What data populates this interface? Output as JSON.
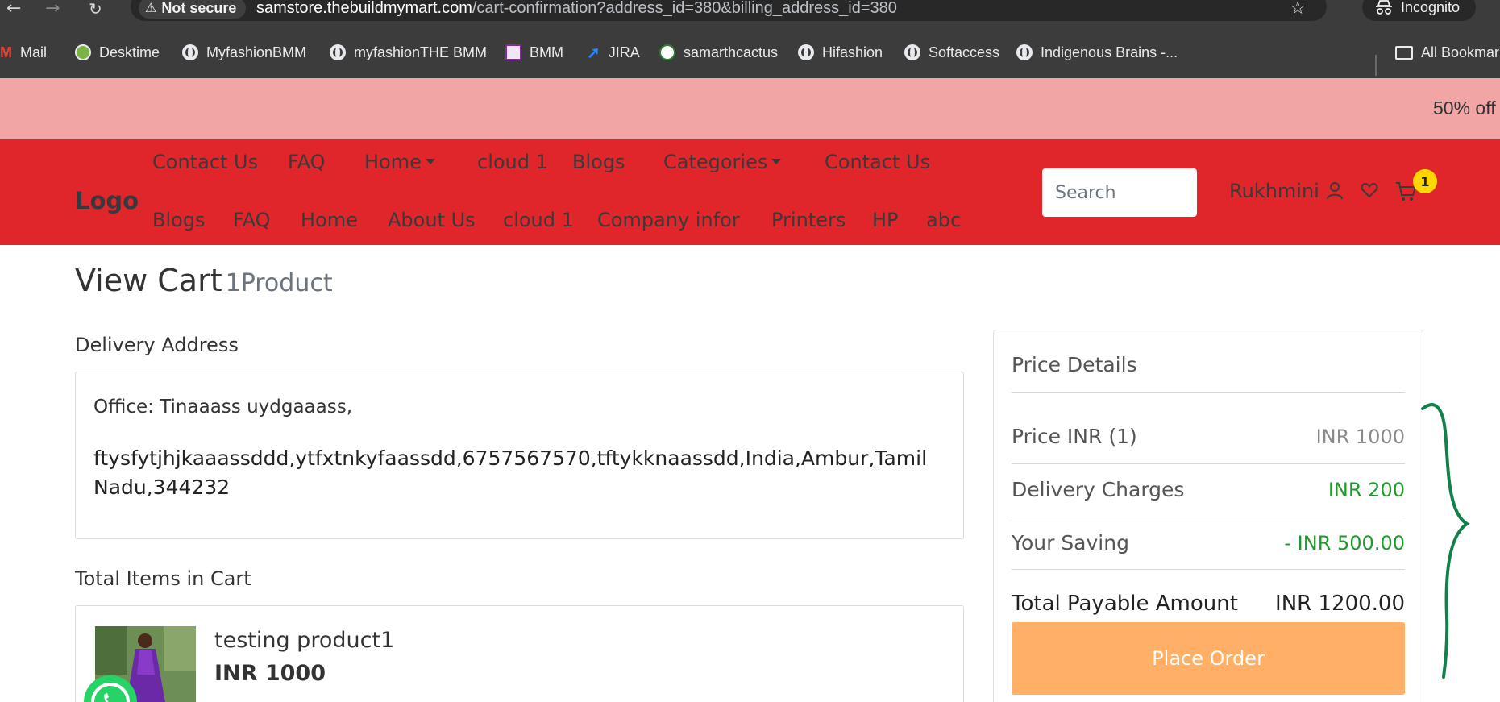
{
  "browser": {
    "security_label": "Not secure",
    "url_host": "samstore.thebuildmymart.com",
    "url_path": "/cart-confirmation?address_id=380&billing_address_id=380",
    "profile_label": "Incognito",
    "bookmarks": [
      "Mail",
      "Desktime",
      "MyfashionBMM",
      "myfashionTHE BMM",
      "BMM",
      "JIRA",
      "samarthcactus",
      "Hifashion",
      "Softaccess",
      "Indigenous Brains -..."
    ],
    "all_bookmarks_label": "All Bookmar"
  },
  "promo": {
    "text": "50% off"
  },
  "header": {
    "logo": "Logo",
    "menu_row1": [
      "Contact Us",
      "FAQ",
      "Home",
      "cloud 1",
      "Blogs",
      "Categories",
      "Contact Us"
    ],
    "menu_row2": [
      "Blogs",
      "FAQ",
      "Home",
      "About Us",
      "cloud 1",
      "Company infor",
      "Printers",
      "HP",
      "abc"
    ],
    "search_placeholder": "Search",
    "user_name": "Rukhmini",
    "cart_count": "1"
  },
  "page": {
    "title": "View Cart",
    "count_label": "1Product",
    "delivery_heading": "Delivery Address",
    "address_label": "Office: Tinaaass uydgaaass,",
    "address_text": "ftysfytjhjkaaassddd,ytfxtnkyfaassdd,6757567570,tftykknaassdd,India,Ambur,Tamil Nadu,344232",
    "items_heading": "Total Items in Cart",
    "product_name": "testing product1",
    "product_price": "INR 1000"
  },
  "price_details": {
    "title": "Price Details",
    "price_label": "Price INR (1)",
    "price_value": "INR 1000",
    "delivery_label": "Delivery Charges",
    "delivery_value": "INR 200",
    "saving_label": "Your Saving",
    "saving_value": "- INR 500.00",
    "total_label": "Total Payable Amount",
    "total_value": "INR  1200.00",
    "place_order_label": "Place Order"
  },
  "colors": {
    "header_red": "#e0262a",
    "promo_pink": "#f2a5a5",
    "place_order_orange": "#ffb066",
    "green_value": "#1e9a2c",
    "annotation_green": "#12804a"
  }
}
